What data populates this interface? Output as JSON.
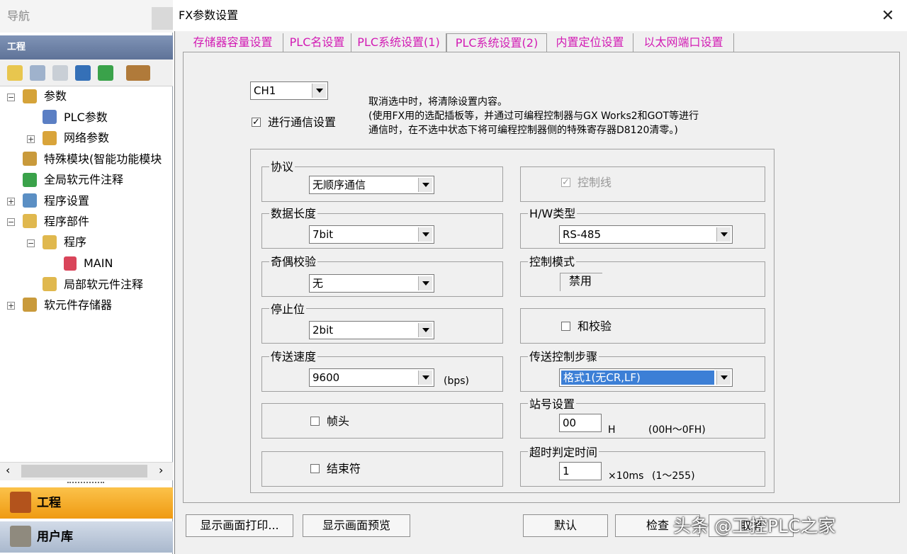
{
  "nav": {
    "title": "导航",
    "section": "工程",
    "tree": [
      {
        "label": "参数"
      },
      {
        "label": "PLC参数"
      },
      {
        "label": "网络参数"
      },
      {
        "label": "特殊模块(智能功能模块"
      },
      {
        "label": "全局软元件注释"
      },
      {
        "label": "程序设置"
      },
      {
        "label": "程序部件"
      },
      {
        "label": "程序"
      },
      {
        "label": "MAIN"
      },
      {
        "label": "局部软元件注释"
      },
      {
        "label": "软元件存储器"
      }
    ],
    "bottom_tabs": [
      {
        "label": "工程"
      },
      {
        "label": "用户库"
      }
    ]
  },
  "dialog": {
    "title": "FX参数设置",
    "tabs": [
      {
        "label": "存储器容量设置"
      },
      {
        "label": "PLC名设置"
      },
      {
        "label": "PLC系统设置(1)"
      },
      {
        "label": "PLC系统设置(2)"
      },
      {
        "label": "内置定位设置"
      },
      {
        "label": "以太网端口设置"
      }
    ],
    "channel": "CH1",
    "comm_setting_label": "进行通信设置",
    "notice": [
      "取消选中时，将清除设置内容。",
      "(使用FX用的选配插板等，并通过可编程控制器与GX Works2和GOT等进行",
      "通信时，在不选中状态下将可编程控制器侧的特殊寄存器D8120清零。)"
    ],
    "protocol": {
      "label": "协议",
      "value": "无顺序通信"
    },
    "data_length": {
      "label": "数据长度",
      "value": "7bit"
    },
    "parity": {
      "label": "奇偶校验",
      "value": "无"
    },
    "stop_bit": {
      "label": "停止位",
      "value": "2bit"
    },
    "baud": {
      "label": "传送速度",
      "value": "9600",
      "unit": "(bps)"
    },
    "header": {
      "label": "帧头"
    },
    "terminator": {
      "label": "结束符"
    },
    "control_line": {
      "label": "控制线"
    },
    "hw_type": {
      "label": "H/W类型",
      "value": "RS-485"
    },
    "control_mode": {
      "label": "控制模式",
      "value": "禁用"
    },
    "checksum": {
      "label": "和校验"
    },
    "transfer_control": {
      "label": "传送控制步骤",
      "value": "格式1(无CR,LF)"
    },
    "station": {
      "label": "站号设置",
      "value": "00",
      "unit": "H",
      "range": "(00H～0FH)"
    },
    "timeout": {
      "label": "超时判定时间",
      "value": "1",
      "unit": "×10ms",
      "range": "(1～255)"
    },
    "buttons": {
      "print": "显示画面打印...",
      "preview": "显示画面预览",
      "default": "默认",
      "check": "检查",
      "cancel": "取消"
    }
  },
  "watermark": "头条 @工控PLC之家",
  "colors": {
    "tab_text": "#d21bb4",
    "selected": "#3c7fd6"
  }
}
